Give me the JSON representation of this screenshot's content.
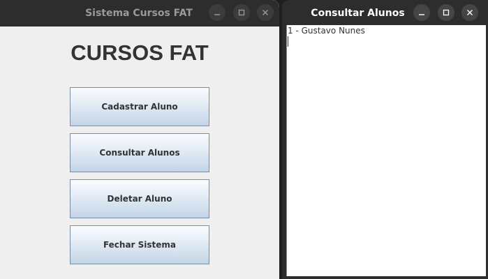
{
  "main_window": {
    "title": "Sistema Cursos FAT",
    "heading": "CURSOS FAT",
    "buttons": {
      "register": "Cadastrar Aluno",
      "consult": "Consultar Alunos",
      "delete": "Deletar Aluno",
      "close": "Fechar Sistema"
    }
  },
  "consult_window": {
    "title": "Consultar Alunos",
    "lines": [
      "1 - Gustavo Nunes"
    ]
  }
}
